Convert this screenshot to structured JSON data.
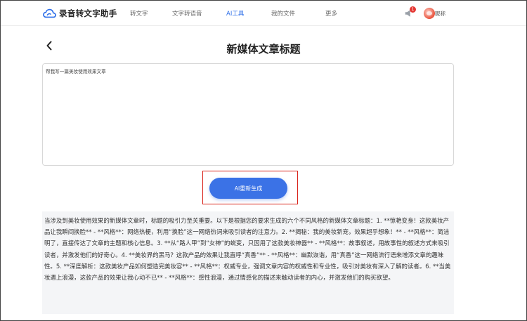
{
  "app": {
    "name": "录音转文字助手"
  },
  "nav": {
    "items": [
      "转文字",
      "文字转语音",
      "AI工具",
      "我的文件",
      "更多"
    ],
    "active": "AI工具"
  },
  "notifications": {
    "count": "1"
  },
  "user": {
    "nickname": "昵称"
  },
  "page": {
    "title": "新媒体文章标题"
  },
  "prompt": {
    "value": "帮我写一篇美妆使用效果文章"
  },
  "actions": {
    "regenerate_label": "AI重新生成"
  },
  "result": {
    "text": "当涉及到美妆使用效果的新媒体文章时，标题的吸引力至关重要。以下是根据您的要求生成的六个不同风格的新媒体文章标题：1. **惊艳变身！这款美妆产品让我瞬间换脸** - **风格**：网络热梗，利用“换脸”这一网络热词来吸引读者的注意力。2. **揭秘：我的美妆新宠，效果超乎想象！** - **风格**：简洁明了，直接传达了文章的主题和核心信息。3. **从“路人甲”到“女神”的蜕变，只因用了这款美妆神器** - **风格**：故事叙述，用故事性的叙述方式来吸引读者，并激发他们的好奇心。4. **美妆界的黑马？这款产品的效果让我直呼“真香”** - **风格**：幽默诙谐，用“真香”这一网络流行语来增添文章的趣味性。5. **深度解析：这款美妆产品如何塑造完美妆容** - **风格**：权威专业，强调文章内容的权威性和专业性，吸引对美妆有深入了解的读者。6. **当美妆遇上浪漫，这款产品的效果让我心动不已** - **风格**：感性浪漫，通过情感化的描述来触动读者的内心，并激发他们的购买欲望。"
  },
  "colors": {
    "accent": "#3b72e6",
    "highlight_border": "#d9241b",
    "badge": "#e53935"
  }
}
